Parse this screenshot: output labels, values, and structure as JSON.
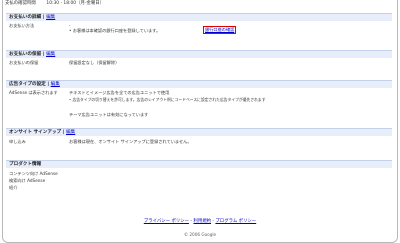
{
  "top_row": {
    "label": "支払の確認時間",
    "value": "10:30 - 18:00（月-金曜日）"
  },
  "payment_details": {
    "title": "お支払いの詳細",
    "edit": "編集",
    "method_label": "お支払い方法",
    "method_dash": "-",
    "method_note": "• お客様は本確認の銀行口座を登録しています。",
    "verify_link": "銀行口座の確認"
  },
  "payment_hold": {
    "title": "お支払いの保留",
    "edit": "編集",
    "status_label": "お支払いの保留",
    "status_value": "保留設定なし（保留解除）"
  },
  "ad_type": {
    "title": "広告タイプの設定",
    "edit": "編集",
    "label": "AdSense は表示されます",
    "line1": "テキストとイメージ広告を全ての広告ユニットで使用",
    "line2": "• 広告タイプの切り替えを許可します。広告のレイアウト例にコードベースに設定された広告タイプが優先されます",
    "line3": "テーマ広告ユニットは有効になっています"
  },
  "onsite_signup": {
    "title": "オンサイト サインアップ",
    "edit": "編集",
    "label": "申し込み",
    "value": "お客様は現在、オンサイト サインアップに登録されていません。"
  },
  "product_info": {
    "title": "プロダクト情報",
    "rows": [
      {
        "label": "コンテンツ向け AdSense"
      },
      {
        "label": "検索向け AdSense"
      },
      {
        "label": "紹介"
      }
    ]
  },
  "footer": {
    "privacy": "プライバシー ポリシー",
    "terms": "利用規約",
    "program_policy": "プログラム ポリシー",
    "sep": "-",
    "copyright": "© 2006 Google"
  }
}
